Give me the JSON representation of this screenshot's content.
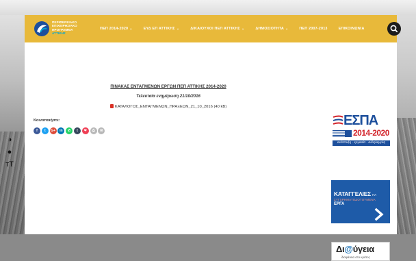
{
  "header": {
    "logo": {
      "lines": [
        "ΠΕΡΙΦΕΡΕΙΑΚΟ",
        "ΕΠΙΧΕΙΡΗΣΙΑΚΟ",
        "ΠΡΟΓΡΑΜΜΑ",
        "ΑΤΤΙΚΗΣ"
      ]
    },
    "nav": [
      {
        "label": "ΠΕΠ 2014-2020",
        "dropdown": true
      },
      {
        "label": "ΕΥΔ ΕΠ ΑΤΤΙΚΗΣ",
        "dropdown": true
      },
      {
        "label": "ΔΙΚΑΙΟΥΧΟΙ ΠΕΠ ΑΤΤΙΚΗΣ",
        "dropdown": true
      },
      {
        "label": "ΔΗΜΟΣΙΟΤΗΤΑ",
        "dropdown": true
      },
      {
        "label": "ΠΕΠ 2007-2013",
        "dropdown": false
      },
      {
        "label": "ΕΠΙΚΟΙΝΩΝΙΑ",
        "dropdown": false
      }
    ],
    "chevron": "⌄",
    "search_icon": "search-icon"
  },
  "content": {
    "title": "ΠΙΝΑΚΑΣ ΕΝΤΑΓΜΕΝΩΝ ΕΡΓΩΝ ΠΕΠ ΑΤΤΙΚΗΣ 2014-2020",
    "updated": "Τελευταία ενημέρωση 21/10/2016",
    "file_link": "ΚΑΤΑΛΟΓΟΣ_ΕΝΤΑΓΜΕΝΩΝ_ΠΡΑΞΕΩΝ_21_10_2016 (40 kB)",
    "share_label": "Κοινοποιήστε:",
    "share_buttons": [
      {
        "name": "facebook",
        "icon": "f",
        "color": "#3b5998"
      },
      {
        "name": "twitter",
        "icon": "t",
        "color": "#1da1f2"
      },
      {
        "name": "google-plus",
        "icon": "G+",
        "color": "#dd4b39"
      },
      {
        "name": "linkedin",
        "icon": "in",
        "color": "#0077b5"
      },
      {
        "name": "whatsapp",
        "icon": "✆",
        "color": "#25d366"
      },
      {
        "name": "tumblr",
        "icon": "t",
        "color": "#35465c"
      },
      {
        "name": "pocket",
        "icon": "❤",
        "color": "#ef4056"
      },
      {
        "name": "print",
        "icon": "⎙",
        "color": "#b8b8b8"
      },
      {
        "name": "email",
        "icon": "✉",
        "color": "#b8b8b8"
      }
    ]
  },
  "sidebar": {
    "espa": {
      "title": "ΕΣΠΑ",
      "years": "2014-2020",
      "slogan": "ανάπτυξη - εργασία - αλληλεγγύη"
    },
    "katagelies": {
      "title": "ΚΑΤΑΓΓΕΛΙΕΣ",
      "title_small": "ΓΙΑ",
      "subtitle": "ΣΥΓΧΡΗΜΑΤΟΔΟΤΟΥΜΕΝΑ",
      "erga": "ΕΡΓΑ"
    },
    "diavgeia": {
      "prefix": "Δι",
      "at": "@",
      "suffix": "ύγεια",
      "subtitle": "διαφάνεια στο κράτος"
    }
  },
  "a11y": {
    "contrast_icon": "◑",
    "grayscale_icon": "●",
    "text_size_icon": "тT"
  }
}
